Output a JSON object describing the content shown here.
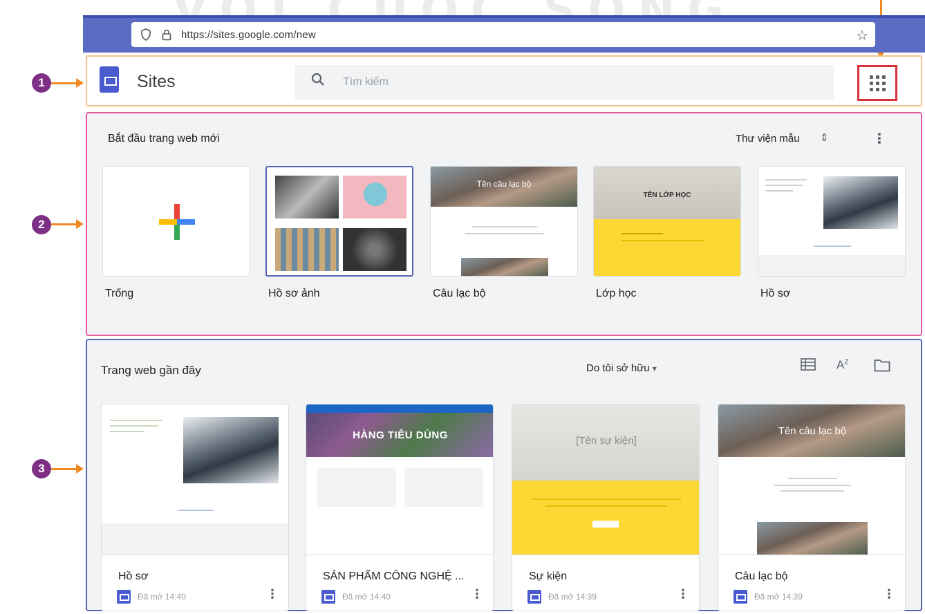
{
  "watermark": "VỚI CUỘC SỐNG",
  "browser": {
    "url": "https://sites.google.com/new"
  },
  "callouts": [
    "1",
    "2",
    "3"
  ],
  "header": {
    "app_title": "Sites",
    "search_placeholder": "Tìm kiếm",
    "apps_icon": "apps-grid-icon"
  },
  "templates": {
    "title": "Bắt đầu trang web mới",
    "gallery_label": "Thư viện mẫu",
    "items": [
      {
        "label": "Trống"
      },
      {
        "label": "Hồ sơ ảnh"
      },
      {
        "label": "Câu lạc bộ",
        "thumb_text": "Tên câu lạc bộ"
      },
      {
        "label": "Lớp học",
        "thumb_text": "TÊN LỚP HỌC"
      },
      {
        "label": "Hồ sơ"
      }
    ]
  },
  "recent": {
    "title": "Trang web gần đây",
    "owner_filter": "Do tôi sở hữu",
    "cards": [
      {
        "name": "Hồ sơ",
        "meta": "Đã mở 14:40"
      },
      {
        "name": "SẢN PHẨM CÔNG NGHỆ ...",
        "meta": "Đã mở 14:40",
        "thumb_text": "HÀNG TIÊU DÙNG"
      },
      {
        "name": "Sự kiện",
        "meta": "Đã mở 14:39",
        "thumb_text": "[Tên sự kiện]"
      },
      {
        "name": "Câu lạc bộ",
        "meta": "Đã mở 14:39",
        "thumb_text": "Tên câu lạc bộ"
      }
    ]
  },
  "colors": {
    "browser_bar": "#5a6cc4",
    "section1_border": "#f0c28a",
    "section2_border": "#e45a9b",
    "section3_border": "#5664b8",
    "callout": "#7e2f86",
    "arrow": "#ef8a22",
    "apps_highlight": "#d8313a",
    "class_yellow": "#fdd835"
  }
}
